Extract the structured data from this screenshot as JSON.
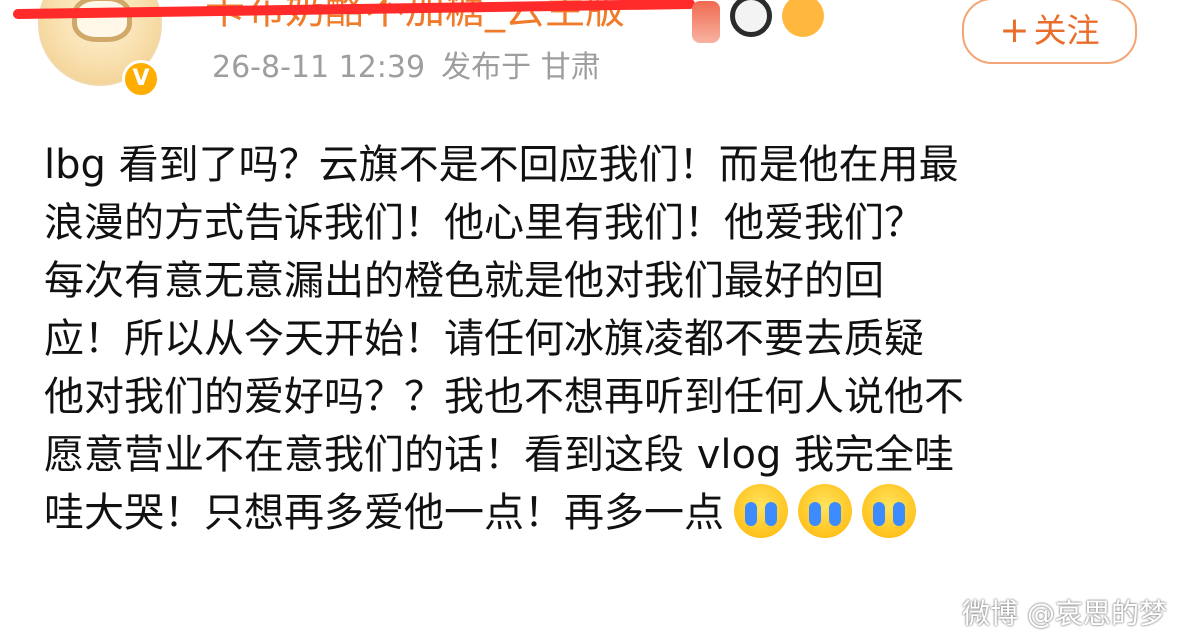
{
  "header": {
    "username": "卡布奶酪不加糖_云主版",
    "timestamp": "26-8-11 12:39",
    "published_location": "发布于 甘肃",
    "follow": {
      "plus": "+",
      "label": "关注"
    },
    "verified_symbol": "V",
    "badge_icons": [
      "hourglass-badge-icon",
      "panda-badge-icon",
      "cat-badge-icon"
    ]
  },
  "post": {
    "lines": [
      "lbg 看到了吗？云旗不是不回应我们！而是他在用最",
      "浪漫的方式告诉我们！他心里有我们！他爱我们？",
      "每次有意无意漏出的橙色就是他对我们最好的回",
      "应！所以从今天开始！请任何冰旗凌都不要去质疑",
      "他对我们的爱好吗？？我也不想再听到任何人说他不",
      "愿意营业不在意我们的话！看到这段 vlog 我完全哇",
      "哇大哭！只想再多爱他一点！再多一点"
    ]
  },
  "watermark": "微博 @哀思的梦",
  "colors": {
    "accent_orange": "#ea6e2b",
    "meta_gray": "#9e9e9e",
    "text": "#111111",
    "redline": "#ff2a2a"
  }
}
